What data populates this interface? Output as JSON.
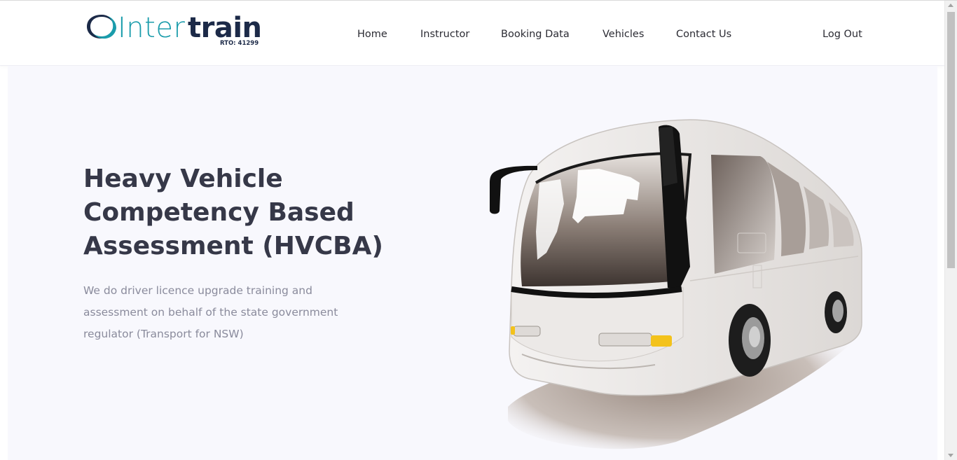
{
  "brand": {
    "name_part1": "Inter",
    "name_part2": "train",
    "rto": "RTO: 41299",
    "logo_icon": "swoosh-circle-icon",
    "colors": {
      "teal": "#1a9cab",
      "navy": "#1c2a48"
    }
  },
  "nav": {
    "items": [
      {
        "label": "Home"
      },
      {
        "label": "Instructor"
      },
      {
        "label": "Booking Data"
      },
      {
        "label": "Vehicles"
      },
      {
        "label": "Contact Us"
      }
    ],
    "logout_label": "Log Out"
  },
  "hero": {
    "title": "Heavy Vehicle Competency Based Assessment (HVCBA)",
    "description": "We do driver licence upgrade training and assessment on behalf of the state government regulator (Transport for NSW)",
    "image": "coach-bus-illustration"
  },
  "theme": {
    "hero_background": "#f8f8fd",
    "heading_color": "#363848",
    "body_color": "#8a8b9c"
  }
}
